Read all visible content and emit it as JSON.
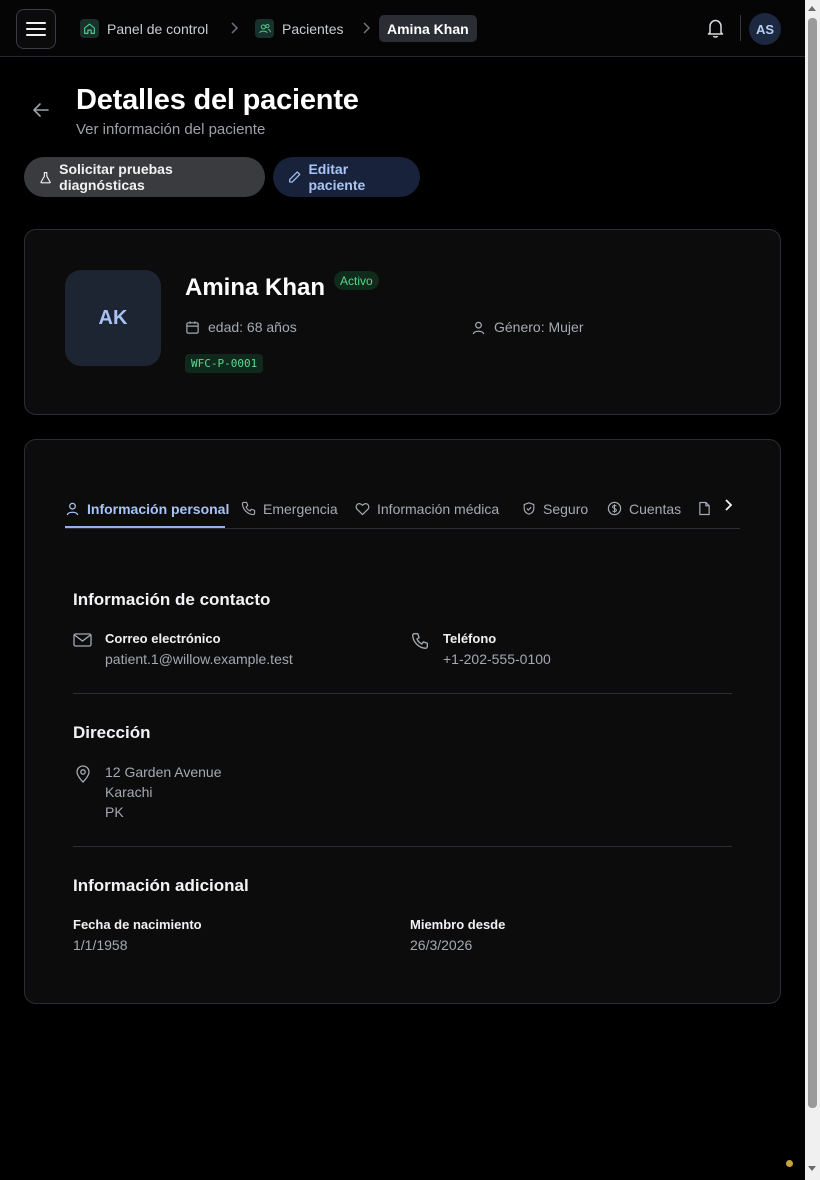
{
  "breadcrumb": {
    "home": "Panel de control",
    "patients": "Pacientes",
    "current": "Amina Khan"
  },
  "user": {
    "initials": "AS"
  },
  "header": {
    "title": "Detalles del paciente",
    "subtitle": "Ver información del paciente"
  },
  "actions": {
    "request_tests": "Solicitar pruebas diagnósticas",
    "edit_patient": "Editar paciente"
  },
  "patient": {
    "initials": "AK",
    "name": "Amina Khan",
    "status": "Activo",
    "age": "edad: 68 años",
    "gender": "Género: Mujer",
    "id": "WFC-P-0001"
  },
  "tabs": [
    {
      "label": "Información personal",
      "icon": "user-icon",
      "active": true
    },
    {
      "label": "Emergencia",
      "icon": "phone-icon"
    },
    {
      "label": "Información médica",
      "icon": "heart-icon"
    },
    {
      "label": "Seguro",
      "icon": "shield-icon"
    },
    {
      "label": "Cuentas",
      "icon": "dollar-icon"
    },
    {
      "label": "",
      "icon": "file-icon"
    }
  ],
  "contact": {
    "title": "Información de contacto",
    "email_label": "Correo electrónico",
    "email": "patient.1@willow.example.test",
    "phone_label": "Teléfono",
    "phone": "+1-202-555-0100"
  },
  "address": {
    "title": "Dirección",
    "line1": "12 Garden Avenue",
    "line2": "Karachi",
    "line3": "PK"
  },
  "additional": {
    "title": "Información adicional",
    "dob_label": "Fecha de nacimiento",
    "dob": "1/1/1958",
    "member_label": "Miembro desde",
    "member_since": "26/3/2026"
  },
  "colors": {
    "accent": "#a8c3f5",
    "success": "#58d68d",
    "background": "#000000"
  }
}
